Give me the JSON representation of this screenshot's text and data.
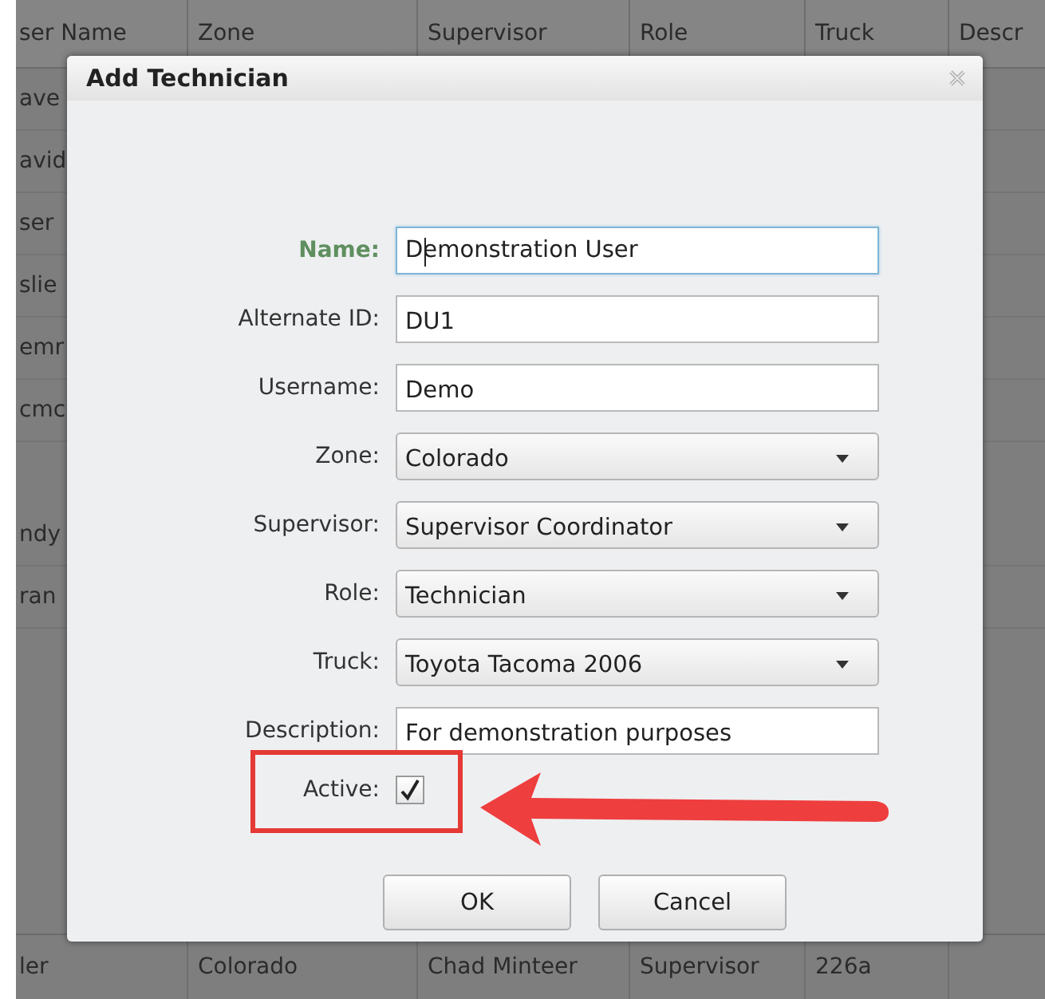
{
  "table": {
    "columns": [
      "ser Name",
      "Zone",
      "Supervisor",
      "Role",
      "Truck",
      "Descr"
    ],
    "rows": [
      {
        "cells": [
          "ave"
        ]
      },
      {
        "cells": [
          "avid"
        ]
      },
      {
        "cells": [
          "ser"
        ]
      },
      {
        "cells": [
          "slie"
        ]
      },
      {
        "cells": [
          "emr"
        ]
      },
      {
        "cells": [
          "cmc"
        ]
      },
      {
        "cells": [
          "ndy"
        ],
        "gap_before": true
      },
      {
        "cells": [
          "ran"
        ]
      }
    ],
    "last_row": {
      "cells": [
        "ler",
        "Colorado",
        "Chad Minteer",
        "Supervisor",
        "226a"
      ]
    }
  },
  "dialog": {
    "title": "Add Technician",
    "fields": [
      {
        "kind": "text",
        "label": "Name:",
        "value": "Demonstration User",
        "focused": true
      },
      {
        "kind": "text",
        "label": "Alternate ID:",
        "value": "DU1",
        "focused": false
      },
      {
        "kind": "text",
        "label": "Username:",
        "value": "Demo",
        "focused": false
      },
      {
        "kind": "select",
        "label": "Zone:",
        "value": "Colorado"
      },
      {
        "kind": "select",
        "label": "Supervisor:",
        "value": "Supervisor Coordinator"
      },
      {
        "kind": "select",
        "label": "Role:",
        "value": "Technician"
      },
      {
        "kind": "select",
        "label": "Truck:",
        "value": "Toyota Tacoma 2006"
      },
      {
        "kind": "text",
        "label": "Description:",
        "value": "For demonstration purposes",
        "focused": false
      },
      {
        "kind": "checkbox",
        "label": "Active:",
        "checked": true
      }
    ],
    "buttons": [
      "OK",
      "Cancel"
    ]
  }
}
